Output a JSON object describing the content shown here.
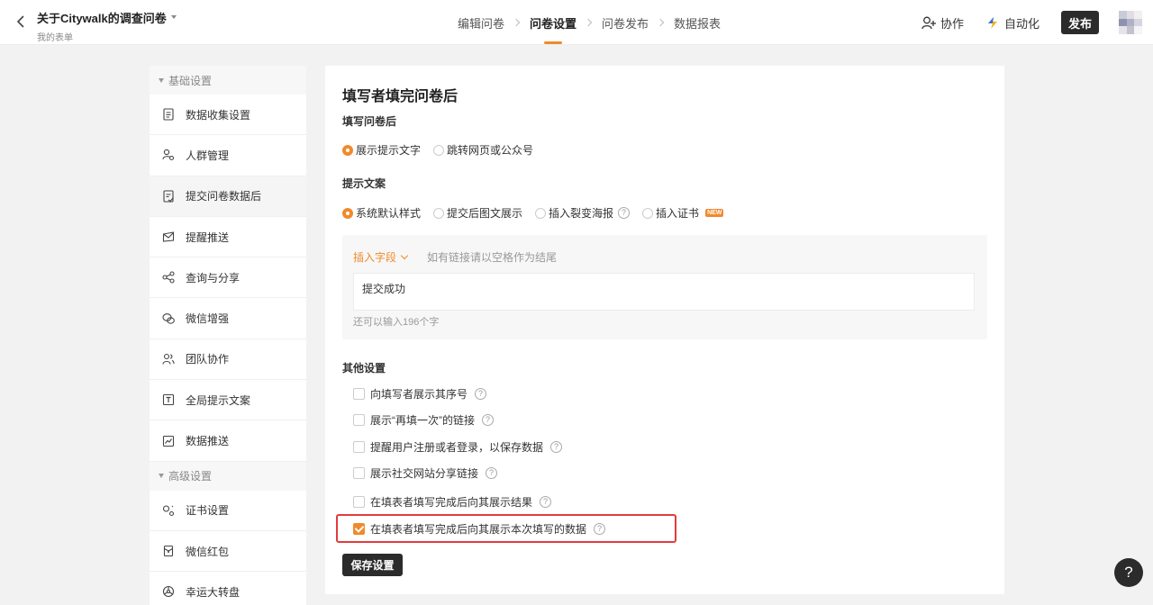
{
  "header": {
    "title": "关于Citywalk的调查问卷",
    "subtitle": "我的表单",
    "steps": [
      {
        "label": "编辑问卷",
        "active": false
      },
      {
        "label": "问卷设置",
        "active": true
      },
      {
        "label": "问卷发布",
        "active": false
      },
      {
        "label": "数据报表",
        "active": false
      }
    ],
    "collab_label": "协作",
    "automation_label": "自动化",
    "publish_label": "发布"
  },
  "sidebar": {
    "basic_group": "基础设置",
    "basic_items": [
      {
        "label": "数据收集设置",
        "icon": "document-icon"
      },
      {
        "label": "人群管理",
        "icon": "user-group-icon"
      },
      {
        "label": "提交问卷数据后",
        "icon": "submit-doc-icon",
        "active": true
      },
      {
        "label": "提醒推送",
        "icon": "envelope-icon"
      },
      {
        "label": "查询与分享",
        "icon": "share-icon"
      },
      {
        "label": "微信增强",
        "icon": "wechat-icon"
      },
      {
        "label": "团队协作",
        "icon": "team-icon"
      },
      {
        "label": "全局提示文案",
        "icon": "text-icon"
      },
      {
        "label": "数据推送",
        "icon": "chart-icon"
      }
    ],
    "advanced_group": "高级设置",
    "advanced_items": [
      {
        "label": "证书设置",
        "icon": "certificate-icon"
      },
      {
        "label": "微信红包",
        "icon": "red-packet-icon"
      },
      {
        "label": "幸运大转盘",
        "icon": "wheel-icon"
      }
    ]
  },
  "panel": {
    "title": "填写者填完问卷后",
    "after_label": "填写问卷后",
    "after_options": [
      "展示提示文字",
      "跳转网页或公众号"
    ],
    "copy_label": "提示文案",
    "copy_options": [
      "系统默认样式",
      "提交后图文展示",
      "插入裂变海报",
      "插入证书"
    ],
    "new_badge": "NEW",
    "editor": {
      "insert_field": "插入字段",
      "hint": "如有链接请以空格作为结尾",
      "content": "提交成功",
      "chars_left": "还可以输入196个字"
    },
    "other_label": "其他设置",
    "other_options": [
      {
        "label": "向填写者展示其序号",
        "checked": false
      },
      {
        "label": "展示“再填一次”的链接",
        "checked": false
      },
      {
        "label": "提醒用户注册或者登录，以保存数据",
        "checked": false
      },
      {
        "label": "展示社交网站分享链接",
        "checked": false
      },
      {
        "label": "在填表者填写完成后向其展示结果",
        "checked": false
      },
      {
        "label": "在填表者填写完成后向其展示本次填写的数据",
        "checked": true
      }
    ],
    "save_label": "保存设置"
  },
  "help_fab": "?",
  "colors": {
    "accent": "#f08a2c",
    "dark": "#2b2b2b",
    "highlight": "#e23c3c"
  }
}
